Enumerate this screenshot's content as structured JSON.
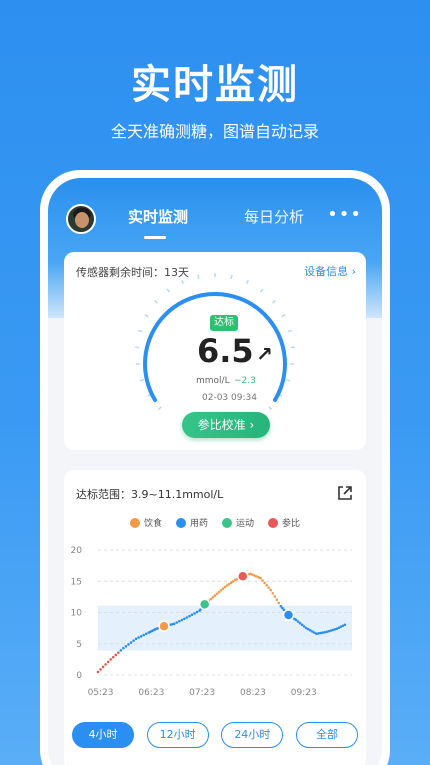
{
  "promo": {
    "title": "实时监测",
    "subtitle": "全天准确测糖，图谱自动记录"
  },
  "header": {
    "tabs": [
      {
        "label": "实时监测",
        "active": true
      },
      {
        "label": "每日分析",
        "active": false
      }
    ],
    "more_icon": "more-dots-icon"
  },
  "sensor_card": {
    "remaining_label": "传感器剩余时间：13天",
    "device_info_label": "设备信息",
    "badge": "达标",
    "reading": "6.5",
    "trend": "↗",
    "unit": "mmol/L",
    "delta": "−2.3",
    "timestamp": "02-03 09:34",
    "calibrate_label": "参比校准"
  },
  "chart_card": {
    "range_label": "达标范围：3.9~11.1mmol/L",
    "legend": [
      {
        "label": "饮食",
        "color": "#f39a4a"
      },
      {
        "label": "用药",
        "color": "#2a8ff0"
      },
      {
        "label": "运动",
        "color": "#3cc38c"
      },
      {
        "label": "参比",
        "color": "#e85a5a"
      }
    ],
    "buttons": [
      {
        "label": "4小时",
        "active": true
      },
      {
        "label": "12小时",
        "active": false
      },
      {
        "label": "24小时",
        "active": false
      },
      {
        "label": "全部",
        "active": false
      }
    ]
  },
  "chart_data": {
    "type": "scatter",
    "x": [
      "05:23",
      "06:23",
      "07:23",
      "08:23",
      "09:23"
    ],
    "yticks": [
      0,
      5,
      10,
      15,
      20
    ],
    "ylim": [
      0,
      20
    ],
    "target_band": [
      3.9,
      11.1
    ],
    "series": [
      {
        "points": [
          [
            0.0,
            0.5
          ],
          [
            0.25,
            2.5
          ],
          [
            0.5,
            4.3
          ],
          [
            0.75,
            5.8
          ],
          [
            1.0,
            6.8
          ],
          [
            1.15,
            7.4
          ],
          [
            1.3,
            7.8
          ],
          [
            1.5,
            8.2
          ],
          [
            1.75,
            9.2
          ],
          [
            2.0,
            10.3
          ],
          [
            2.1,
            11.3
          ],
          [
            2.3,
            12.7
          ],
          [
            2.5,
            14.1
          ],
          [
            2.7,
            15.2
          ],
          [
            2.85,
            15.8
          ],
          [
            3.0,
            16.2
          ],
          [
            3.2,
            15.5
          ],
          [
            3.4,
            13.6
          ],
          [
            3.6,
            11.0
          ],
          [
            3.75,
            9.6
          ],
          [
            3.9,
            8.8
          ],
          [
            4.1,
            7.5
          ],
          [
            4.3,
            6.6
          ],
          [
            4.5,
            6.9
          ],
          [
            4.7,
            7.4
          ],
          [
            4.9,
            8.2
          ]
        ]
      }
    ],
    "events": [
      {
        "type": "饮食",
        "x": 1.3,
        "y": 7.8
      },
      {
        "type": "运动",
        "x": 2.1,
        "y": 11.3
      },
      {
        "type": "参比",
        "x": 2.85,
        "y": 15.8
      },
      {
        "type": "用药",
        "x": 3.75,
        "y": 9.6
      }
    ]
  }
}
